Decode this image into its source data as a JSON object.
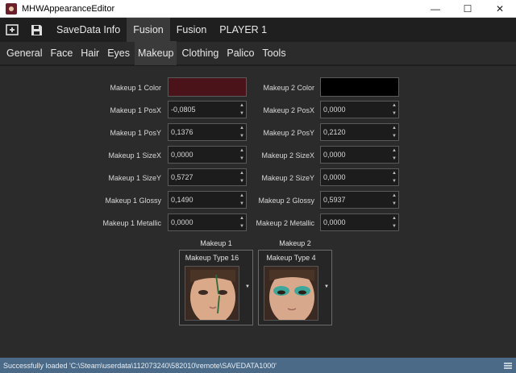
{
  "window": {
    "title": "MHWAppearanceEditor",
    "minimize": "—",
    "maximize": "☐",
    "close": "✕"
  },
  "toolbar": {
    "new_icon": "new-file-icon",
    "save_icon": "save-icon",
    "tabs": [
      "SaveData Info",
      "Fusion",
      "Fusion",
      "PLAYER 1"
    ]
  },
  "subtabs": [
    "General",
    "Face",
    "Hair",
    "Eyes",
    "Makeup",
    "Clothing",
    "Palico",
    "Tools"
  ],
  "makeup1": {
    "color_label": "Makeup 1 Color",
    "color": "#4a1219",
    "posx_label": "Makeup 1 PosX",
    "posx": "-0,0805",
    "posy_label": "Makeup 1 PosY",
    "posy": "0,1376",
    "sizex_label": "Makeup 1 SizeX",
    "sizex": "0,0000",
    "sizey_label": "Makeup 1 SizeY",
    "sizey": "0,5727",
    "glossy_label": "Makeup 1 Glossy",
    "glossy": "0,1490",
    "metallic_label": "Makeup 1 Metallic",
    "metallic": "0,0000",
    "section_title": "Makeup 1",
    "type": "Makeup Type 16"
  },
  "makeup2": {
    "color_label": "Makeup 2 Color",
    "color": "#000000",
    "posx_label": "Makeup 2 PosX",
    "posx": "0,0000",
    "posy_label": "Makeup 2 PosY",
    "posy": "0,2120",
    "sizex_label": "Makeup 2 SizeX",
    "sizex": "0,0000",
    "sizey_label": "Makeup 2 SizeY",
    "sizey": "0,0000",
    "glossy_label": "Makeup 2 Glossy",
    "glossy": "0,5937",
    "metallic_label": "Makeup 2 Metallic",
    "metallic": "0,0000",
    "section_title": "Makeup 2",
    "type": "Makeup Type 4"
  },
  "status": {
    "text": "Successfully loaded 'C:\\Steam\\userdata\\112073240\\582010\\remote\\SAVEDATA1000'",
    "menu_icon": "menu-icon"
  }
}
